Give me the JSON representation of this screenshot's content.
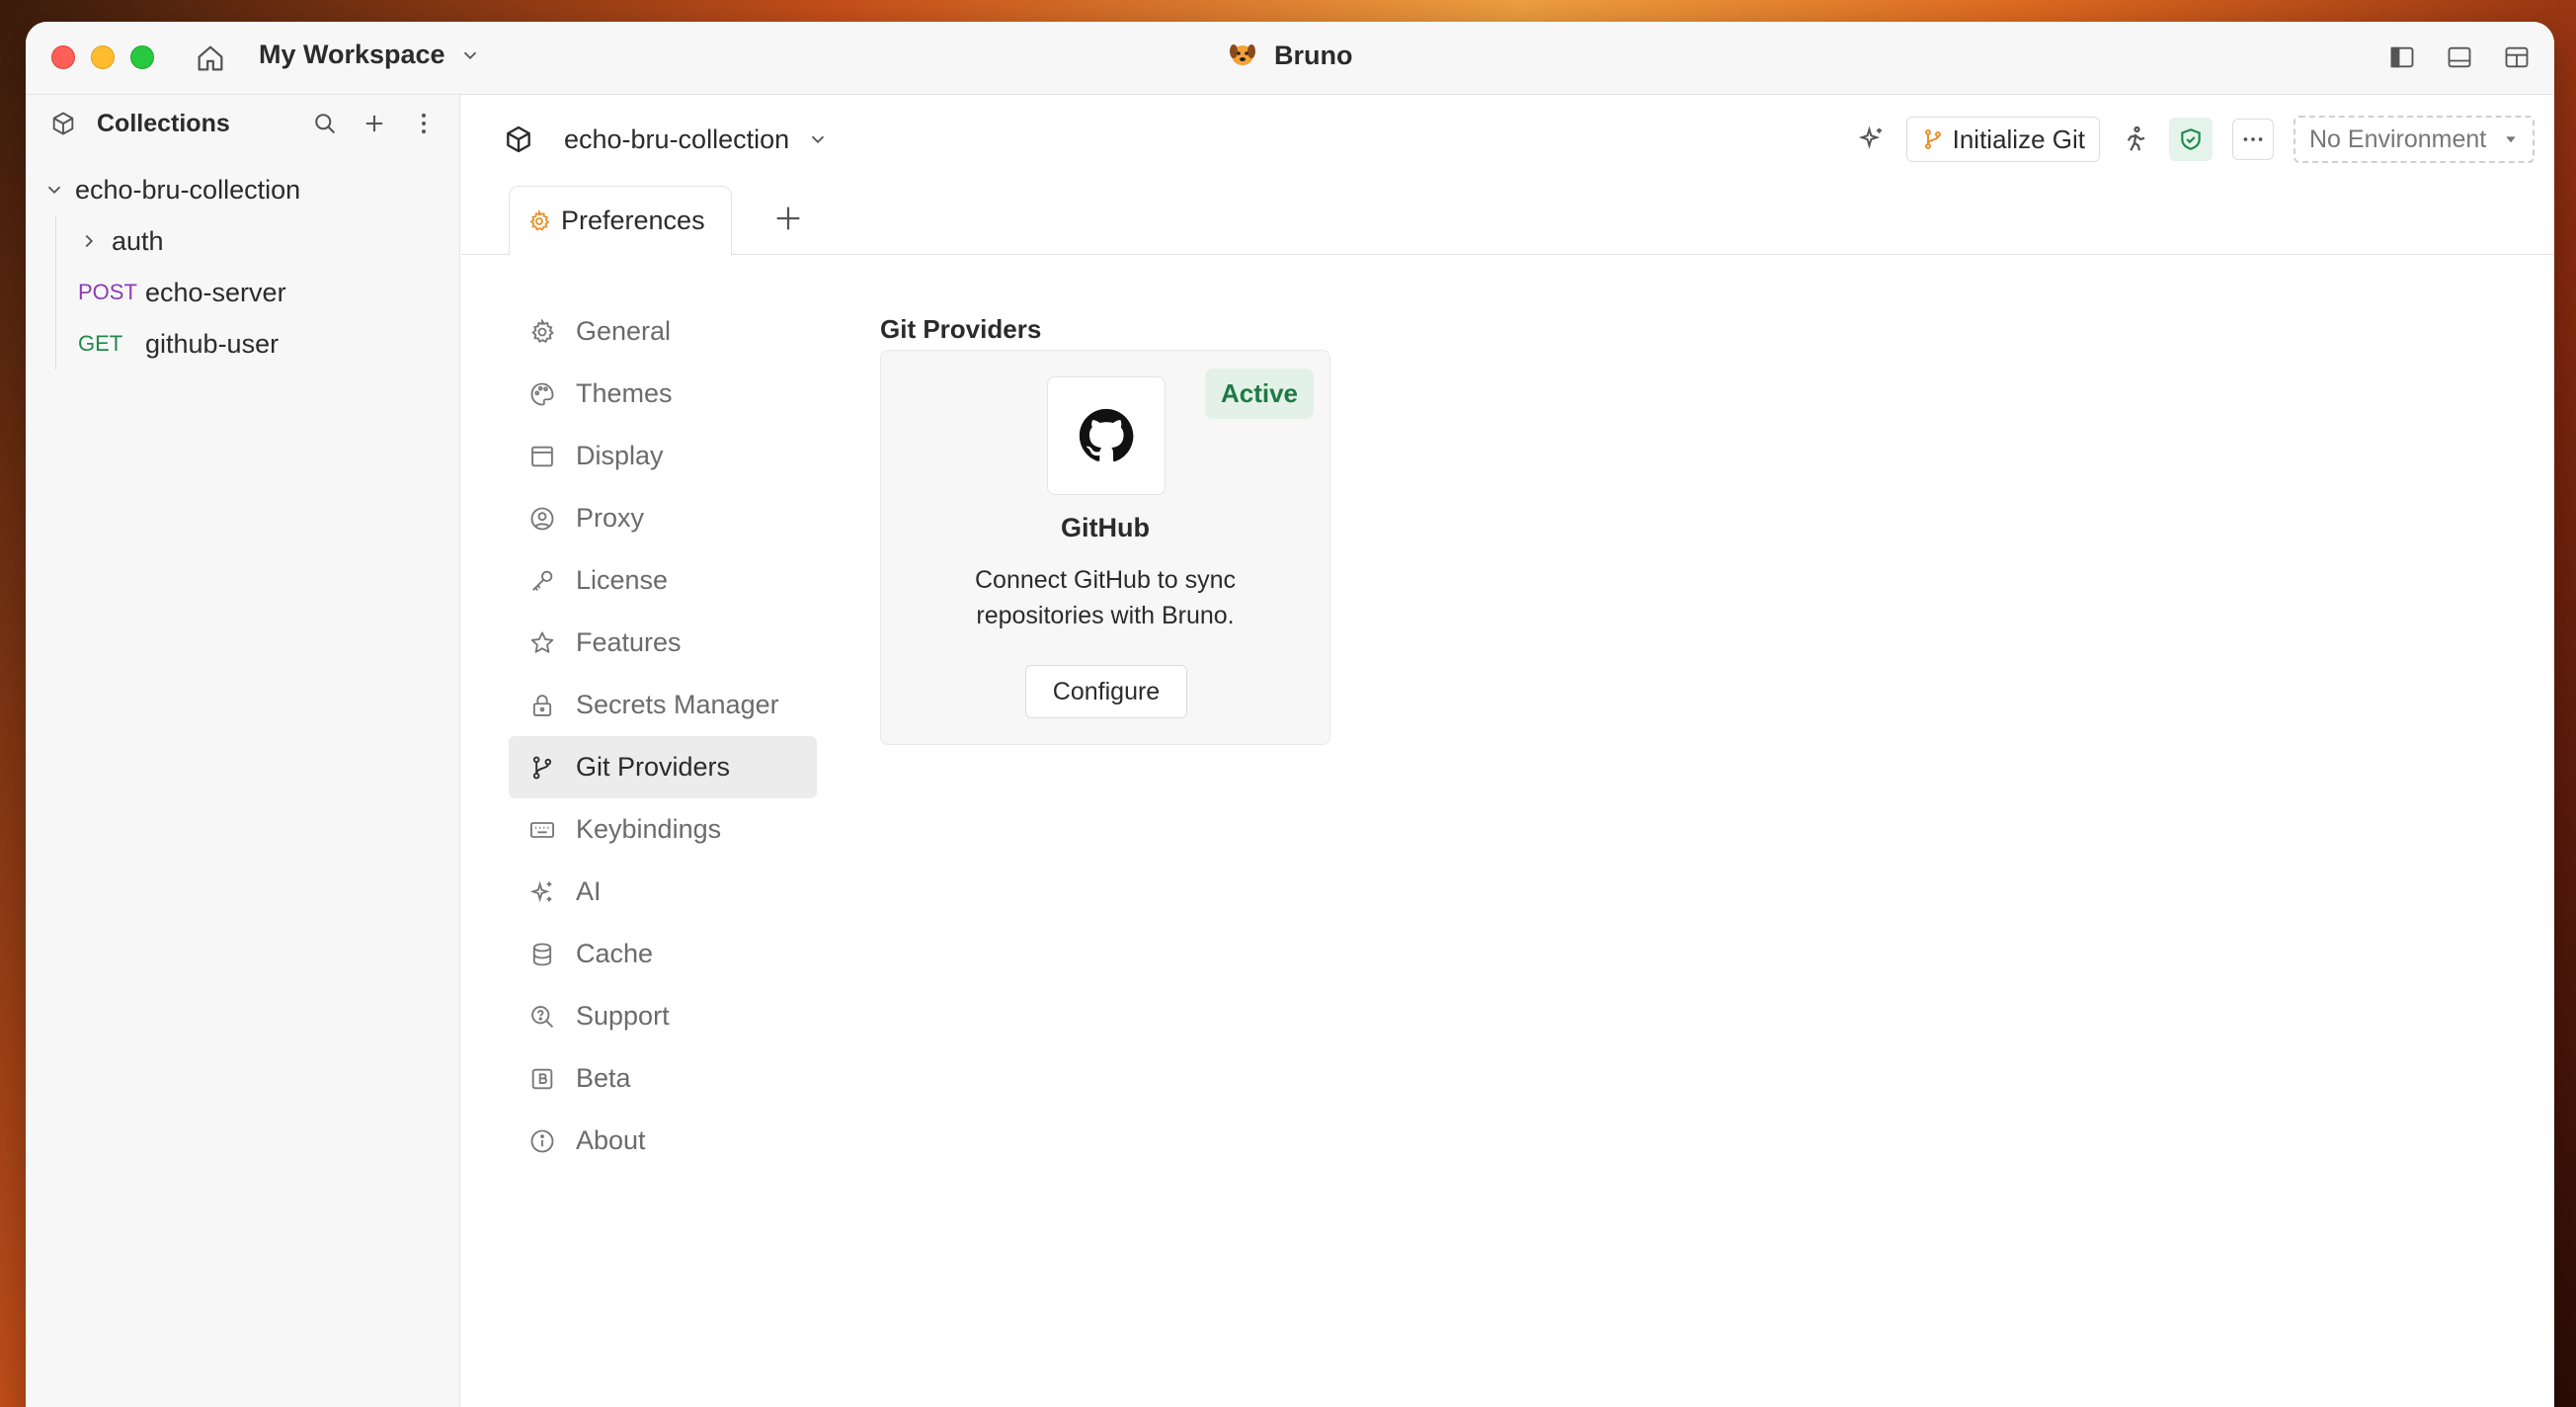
{
  "window": {
    "workspace_label": "My Workspace",
    "app_title": "Bruno"
  },
  "sidebar": {
    "title": "Collections",
    "collection": "echo-bru-collection",
    "items": [
      {
        "type": "folder",
        "label": "auth"
      },
      {
        "type": "request",
        "method": "POST",
        "label": "echo-server"
      },
      {
        "type": "request",
        "method": "GET",
        "label": "github-user"
      }
    ]
  },
  "collection_bar": {
    "name": "echo-bru-collection",
    "git_button": "Initialize Git",
    "environment": "No Environment"
  },
  "tabs": [
    {
      "label": "Preferences",
      "icon": "gear-icon",
      "accent": "#e8912d"
    }
  ],
  "preferences": {
    "nav": [
      {
        "label": "General",
        "icon": "gear-icon"
      },
      {
        "label": "Themes",
        "icon": "palette-icon"
      },
      {
        "label": "Display",
        "icon": "window-icon"
      },
      {
        "label": "Proxy",
        "icon": "user-circle-icon"
      },
      {
        "label": "License",
        "icon": "key-icon"
      },
      {
        "label": "Features",
        "icon": "star-icon"
      },
      {
        "label": "Secrets Manager",
        "icon": "lock-icon"
      },
      {
        "label": "Git Providers",
        "icon": "git-branch-icon",
        "active": true
      },
      {
        "label": "Keybindings",
        "icon": "keyboard-icon"
      },
      {
        "label": "AI",
        "icon": "sparkles-icon"
      },
      {
        "label": "Cache",
        "icon": "database-icon"
      },
      {
        "label": "Support",
        "icon": "search-help-icon"
      },
      {
        "label": "Beta",
        "icon": "beta-icon"
      },
      {
        "label": "About",
        "icon": "info-icon"
      }
    ],
    "section_title": "Git Providers",
    "provider": {
      "name": "GitHub",
      "status": "Active",
      "description": "Connect GitHub to sync repositories with Bruno.",
      "action": "Configure",
      "status_color": "#1f7a43"
    }
  }
}
